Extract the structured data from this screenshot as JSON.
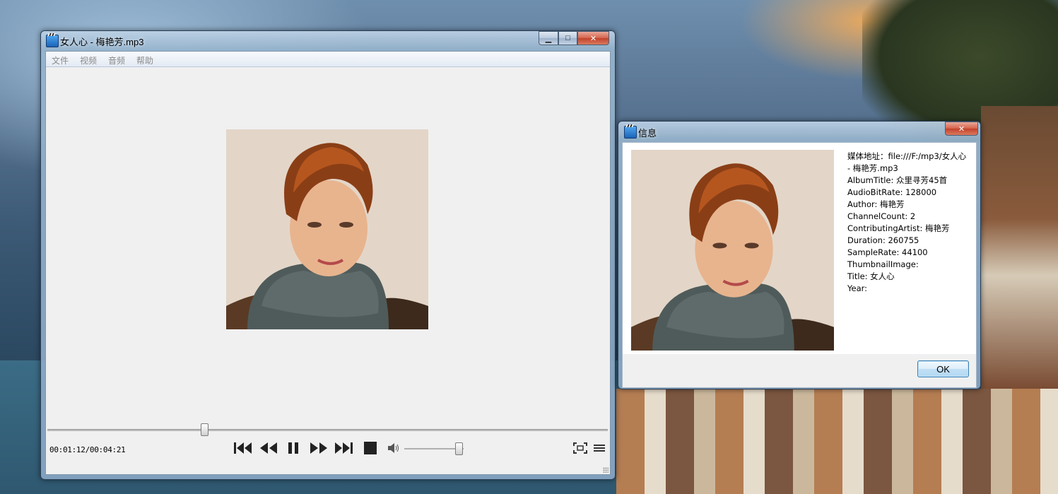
{
  "player": {
    "title": "女人心 - 梅艳芳.mp3",
    "menu": [
      "文件",
      "视频",
      "音频",
      "帮助"
    ],
    "time_display": "00:01:12/00:04:21",
    "seek_progress": 0.28,
    "volume_level": 0.92,
    "controls": [
      "skip-back-icon",
      "rewind-icon",
      "pause-icon",
      "fast-forward-icon",
      "skip-forward-icon",
      "stop-icon",
      "volume-icon",
      "fullscreen-icon",
      "playlist-icon"
    ]
  },
  "info_dialog": {
    "title": "信息",
    "lines": [
      "媒体地址：file:///F:/mp3/女人心 - 梅艳芳.mp3",
      "AlbumTitle: 众里寻芳45首",
      "AudioBitRate: 128000",
      "Author: 梅艳芳",
      "ChannelCount: 2",
      "ContributingArtist: 梅艳芳",
      "Duration: 260755",
      "SampleRate: 44100",
      "ThumbnailImage:",
      "Title: 女人心",
      "Year:"
    ],
    "ok_label": "OK"
  },
  "caption_buttons": {
    "minimize": "▁",
    "maximize": "□",
    "close": "✕"
  }
}
